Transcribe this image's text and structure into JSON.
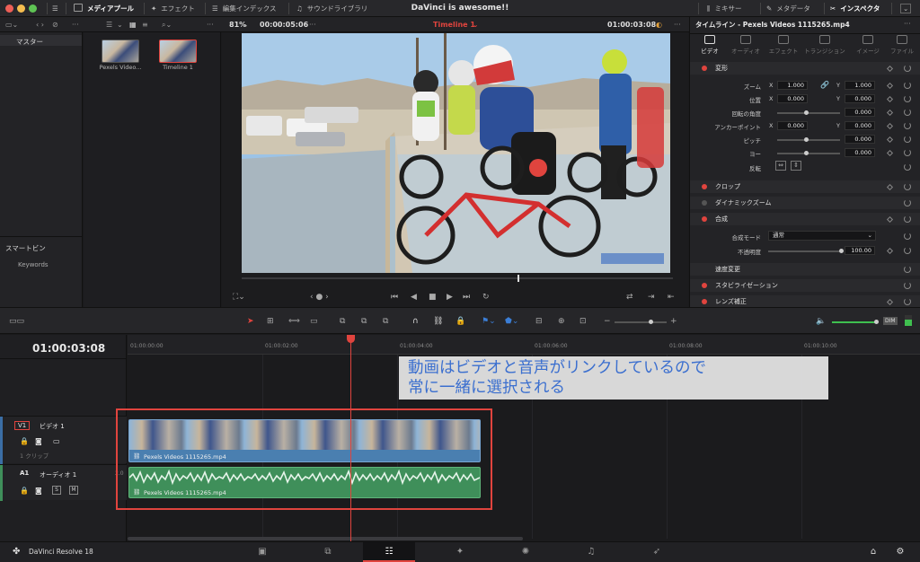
{
  "window": {
    "title": "DaVinci is awesome!!"
  },
  "top_nav": {
    "media_pool": "メディアプール",
    "effects": "エフェクト",
    "edit_index": "編集インデックス",
    "sound_library": "サウンドライブラリ",
    "mixer": "ミキサー",
    "metadata": "メタデータ",
    "inspector": "インスペクタ"
  },
  "media_pool": {
    "master_label": "マスター",
    "smart_bin_label": "スマートビン",
    "keywords_label": "Keywords",
    "clips": [
      {
        "name": "Pexels Video..."
      },
      {
        "name": "Timeline 1"
      }
    ]
  },
  "viewer": {
    "zoom": "81%",
    "source_timecode": "00:00:05:06",
    "timeline_name": "Timeline 1",
    "record_timecode": "01:00:03:08"
  },
  "inspector": {
    "title": "タイムライン - Pexels Videos 1115265.mp4",
    "tabs": [
      "ビデオ",
      "オーディオ",
      "エフェクト",
      "トランジション",
      "イメージ",
      "ファイル"
    ],
    "sections": {
      "transform": "変形",
      "crop": "クロップ",
      "dynamic_zoom": "ダイナミックズーム",
      "composite": "合成",
      "speed_change": "速度変更",
      "stabilization": "スタビライゼーション",
      "lens_correction": "レンズ補正"
    },
    "props": {
      "zoom": "ズーム",
      "position": "位置",
      "rotation": "回転の角度",
      "anchor": "アンカーポイント",
      "pitch": "ピッチ",
      "yaw": "ヨー",
      "flip": "反転",
      "composite_mode": "合成モード",
      "opacity": "不透明度"
    },
    "values": {
      "zoom_x": "1.000",
      "zoom_y": "1.000",
      "pos_x": "0.000",
      "pos_y": "0.000",
      "rotation": "0.000",
      "anchor_x": "0.000",
      "anchor_y": "0.000",
      "pitch": "0.000",
      "yaw": "0.000",
      "composite_mode": "通常",
      "opacity": "100.00"
    },
    "axis_x": "X",
    "axis_y": "Y"
  },
  "timeline": {
    "timecode": "01:00:03:08",
    "ruler": [
      "01:00:00:00",
      "01:00:02:00",
      "01:00:04:00",
      "01:00:06:00",
      "01:00:08:00",
      "01:00:10:00"
    ],
    "video_track": {
      "id": "V1",
      "name": "ビデオ 1",
      "clip_count": "1 クリップ",
      "clip_name": "Pexels Videos 1115265.mp4"
    },
    "audio_track": {
      "id": "A1",
      "name": "オーディオ 1",
      "level": "2.0",
      "clip_name": "Pexels Videos 1115265.mp4",
      "s_label": "S",
      "m_label": "M"
    },
    "dim_label": "DIM"
  },
  "annotation": {
    "line1": "動画はビデオと音声がリンクしているので",
    "line2": "常に一緒に選択される"
  },
  "bottom": {
    "app_name": "DaVinci Resolve 18"
  },
  "colors": {
    "accent_red": "#e0443e",
    "video_clip": "#4a7fb0",
    "audio_clip": "#3f8f5a",
    "annotation_text": "#3b6fcf"
  }
}
